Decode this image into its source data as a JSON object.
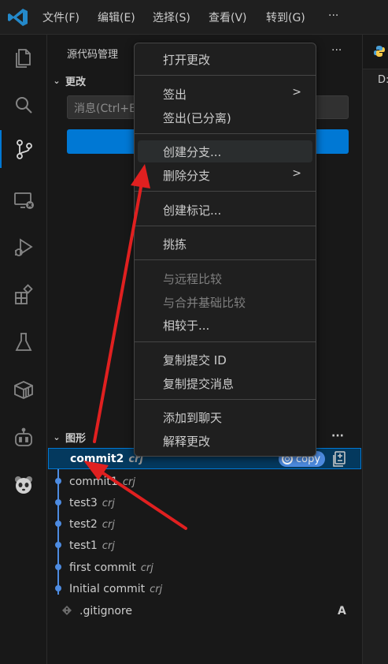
{
  "titlebar": {
    "menus": [
      "文件(F)",
      "编辑(E)",
      "选择(S)",
      "查看(V)",
      "转到(G)",
      "···"
    ]
  },
  "activity": [
    "explorer-icon",
    "search-icon",
    "source-control-icon",
    "remote-explorer-icon",
    "run-debug-icon",
    "extensions-icon",
    "testing-icon",
    "containers-icon",
    "copilot-icon",
    "panda-icon"
  ],
  "scm": {
    "panel_title": "源代码管理",
    "more": "···",
    "changes_title": "更改",
    "message_placeholder": "消息(Ctrl+E",
    "graph_title": "图形",
    "graph_more": "···"
  },
  "graph": {
    "rows": [
      {
        "message": "commit2",
        "author": "crj",
        "badge": "copy"
      },
      {
        "message": "commit1",
        "author": "crj"
      },
      {
        "message": "test3",
        "author": "crj"
      },
      {
        "message": "test2",
        "author": "crj"
      },
      {
        "message": "test1",
        "author": "crj"
      },
      {
        "message": "first commit",
        "author": "crj"
      },
      {
        "message": "Initial commit",
        "author": "crj"
      }
    ],
    "file": {
      "name": ".gitignore",
      "status": "A"
    }
  },
  "editor": {
    "breadcrumb": "D:"
  },
  "context_menu": {
    "items": [
      {
        "label": "打开更改",
        "state": "normal"
      },
      {
        "label": "签出",
        "state": "normal",
        "submenu": true
      },
      {
        "label": "签出(已分离)",
        "state": "normal"
      },
      {
        "label": "创建分支...",
        "state": "hover"
      },
      {
        "label": "删除分支",
        "state": "normal",
        "submenu": true
      },
      {
        "label": "创建标记...",
        "state": "normal"
      },
      {
        "label": "挑拣",
        "state": "normal"
      },
      {
        "label": "与远程比较",
        "state": "disabled"
      },
      {
        "label": "与合并基础比较",
        "state": "disabled"
      },
      {
        "label": "相较于...",
        "state": "normal"
      },
      {
        "label": "复制提交 ID",
        "state": "normal"
      },
      {
        "label": "复制提交消息",
        "state": "normal"
      },
      {
        "label": "添加到聊天",
        "state": "normal"
      },
      {
        "label": "解释更改",
        "state": "normal"
      }
    ]
  },
  "colors": {
    "accent": "#0078d4",
    "annotation_arrow": "#e02020",
    "graph_line": "#4d8be0"
  }
}
